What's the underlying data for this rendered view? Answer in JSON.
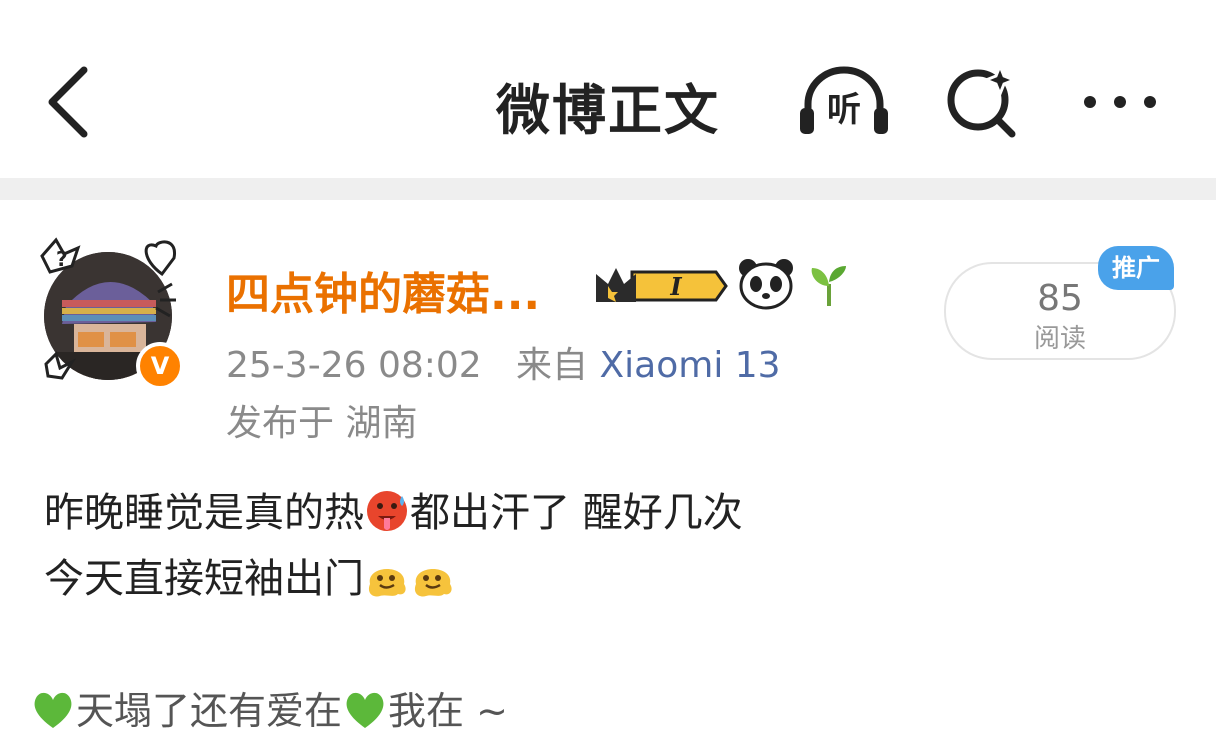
{
  "header": {
    "title": "微博正文",
    "listen_label": "听"
  },
  "post": {
    "author": {
      "name": "四点钟的蘑菇...",
      "verified_mark": "V",
      "level_badge": "I"
    },
    "timestamp": "25-3-26 08:02",
    "source_prefix": "来自",
    "source_device": "Xiaomi 13",
    "location": "发布于 湖南",
    "stats": {
      "read_count": "85",
      "read_label": "阅读"
    },
    "promo_badge": "推广",
    "text_line1_a": "昨晚睡觉是真的热",
    "text_line1_b": "都出汗了 醒好几次",
    "text_line2": "今天直接短袖出门",
    "signature_a": "天塌了还有爱在",
    "signature_b": "我在 ~"
  },
  "icons": [
    "back-chevron-icon",
    "headphones-icon",
    "search-sparkle-icon",
    "more-dots-icon",
    "crown-icon",
    "panda-icon",
    "sprout-icon",
    "hot-face-emoji",
    "melting-face-emoji",
    "green-heart-emoji"
  ],
  "colors": {
    "username": "#ea7100",
    "verified": "#ff8200",
    "device_link": "#4f6ba6",
    "promo": "#4aa2ea",
    "meta": "#8a8a8a"
  }
}
